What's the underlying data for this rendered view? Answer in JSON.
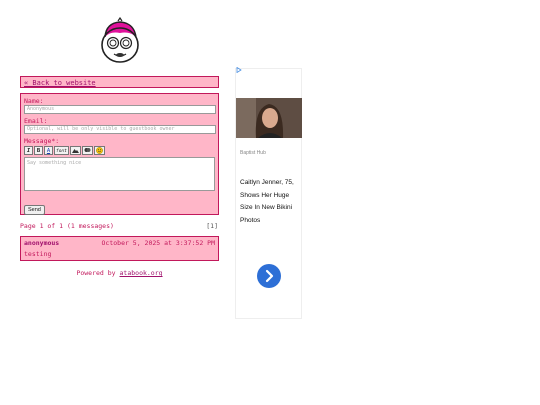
{
  "nav": {
    "back_link": "« Back to website"
  },
  "form": {
    "name_label": "Name:",
    "name_placeholder": "Anonymous",
    "email_label": "Email:",
    "email_placeholder": "Optional, will be only visible to guestbook owner",
    "message_label": "Message*:",
    "message_placeholder": "Say something nice",
    "toolbar": {
      "italic": "I",
      "bold": "B",
      "color": "A",
      "font": "font",
      "image": "image-icon",
      "link": "link-icon",
      "emoji": "smiley-icon"
    },
    "send_label": "Send"
  },
  "pager": {
    "summary": "Page 1 of 1 (1 messages)",
    "pages": "[1]"
  },
  "messages": [
    {
      "author": "anonymous",
      "date": "October 5, 2025 at 3:37:52 PM",
      "text": "testing"
    }
  ],
  "footer": {
    "powered_by": "Powered by",
    "link": "atabook.org"
  },
  "ad": {
    "source": "Baptist Hub",
    "title": "Caitlyn Jenner, 75, Shows Her Huge Size In New Bikini Photos",
    "accent": "#2d6fd6"
  },
  "colors": {
    "panel": "#ffb6c8",
    "border": "#c2185b",
    "text": "#c2185b"
  }
}
